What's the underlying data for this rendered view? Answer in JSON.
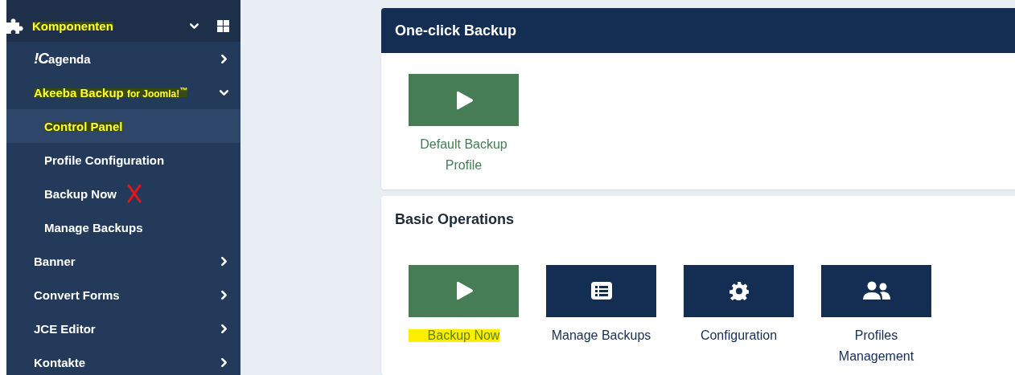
{
  "sidebar": {
    "header": {
      "label": "Komponenten",
      "expanded": true,
      "highlighted": true
    },
    "items": [
      {
        "logo": "!C",
        "label": "agenda",
        "expanded": false,
        "highlighted": false
      },
      {
        "label": "Akeeba Backup",
        "suffix": "for Joomla!$^{™}$",
        "expanded": true,
        "highlighted": true,
        "children": [
          {
            "label": "Control Panel",
            "selected": true,
            "highlighted": true,
            "crossed": false
          },
          {
            "label": "Profile Configuration",
            "selected": false,
            "highlighted": false,
            "crossed": false
          },
          {
            "label": "Backup Now",
            "selected": false,
            "highlighted": false,
            "crossed": true
          },
          {
            "label": "Manage Backups",
            "selected": false,
            "highlighted": false,
            "crossed": false
          }
        ]
      },
      {
        "label": "Banner",
        "expanded": false,
        "highlighted": false
      },
      {
        "label": "Convert Forms",
        "expanded": false,
        "highlighted": false
      },
      {
        "label": "JCE Editor",
        "expanded": false,
        "highlighted": false
      },
      {
        "label": "Kontakte",
        "expanded": false,
        "highlighted": false
      }
    ]
  },
  "cards": [
    {
      "title": "One-click Backup",
      "kind": "banner",
      "tiles": [
        {
          "label": "Default Backup Profile",
          "kind": "play",
          "color": "#467d55",
          "highlighted": false
        }
      ]
    },
    {
      "title": "Basic Operations",
      "kind": "plain",
      "tiles": [
        {
          "label": "Backup Now",
          "kind": "play",
          "color": "#467d55",
          "highlighted": true
        },
        {
          "label": "Manage Backups",
          "kind": "list",
          "color": "#142d53",
          "highlighted": false
        },
        {
          "label": "Configuration",
          "kind": "gear",
          "color": "#142d53",
          "highlighted": false
        },
        {
          "label": "Profiles Management",
          "kind": "users",
          "color": "#142d53",
          "highlighted": false
        }
      ]
    }
  ]
}
